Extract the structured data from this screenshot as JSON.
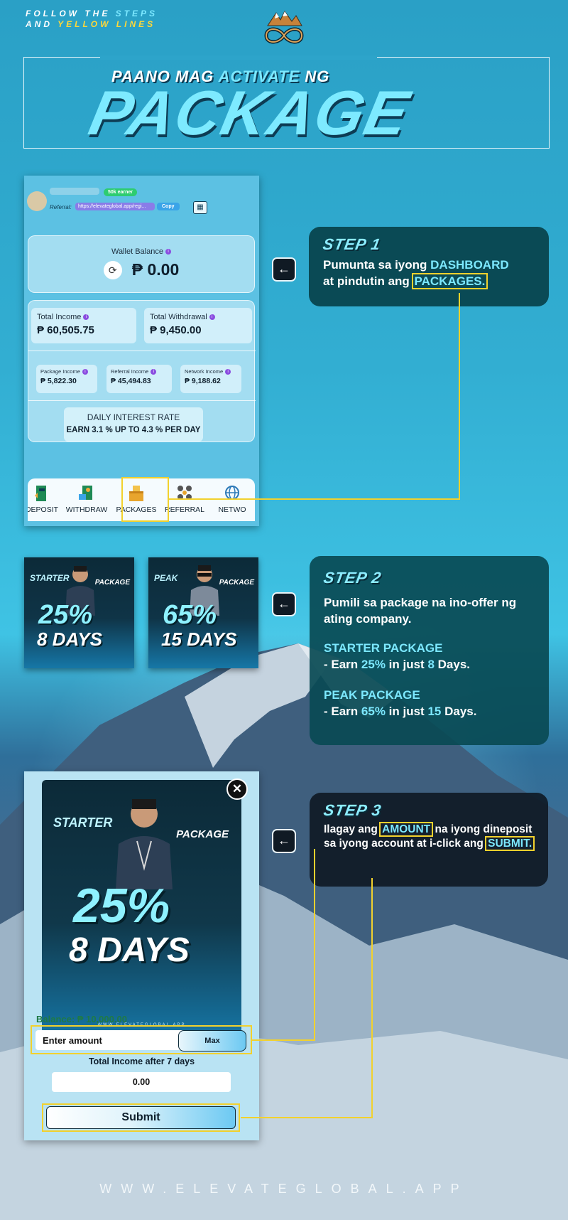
{
  "header": {
    "note_line1_prefix": "FOLLOW THE ",
    "note_line1_accent": "STEPS",
    "note_line2_prefix": "AND ",
    "note_line2_accent": "YELLOW LINES",
    "subtitle_prefix": "PAANO MAG ",
    "subtitle_accent": "ACTIVATE",
    "subtitle_suffix": " NG",
    "title": "PACKAGE"
  },
  "dashboard": {
    "badge": "50k earner",
    "referral_label": "Referral:",
    "referral_link": "https://elevateglobal.app/regi...",
    "copy_label": "Copy",
    "wallet_label": "Wallet Balance",
    "wallet_amount": "₱ 0.00",
    "total_income_label": "Total Income",
    "total_income_value": "₱ 60,505.75",
    "total_withdrawal_label": "Total Withdrawal",
    "total_withdrawal_value": "₱ 9,450.00",
    "package_income_label": "Package Income",
    "package_income_value": "₱ 5,822.30",
    "referral_income_label": "Referral Income",
    "referral_income_value": "₱ 45,494.83",
    "network_income_label": "Network Income",
    "network_income_value": "₱ 9,188.62",
    "rate_label": "DAILY INTEREST RATE",
    "rate_value": "EARN 3.1 % UP TO 4.3 % PER DAY",
    "nav": {
      "deposit": "DEPOSIT",
      "withdraw": "WITHDRAW",
      "packages": "PACKAGES",
      "referral": "REFERRAL",
      "network": "NETWO"
    }
  },
  "step1": {
    "title": "STEP 1",
    "text_a": "Pumunta sa iyong ",
    "text_b": "DASHBOARD",
    "text_c": "at pindutin ang ",
    "text_d": "PACKAGES."
  },
  "thumbs": {
    "starter": {
      "name": "STARTER",
      "package": "PACKAGE",
      "percent": "25%",
      "days": "8 DAYS"
    },
    "peak": {
      "name": "PEAK",
      "package": "PACKAGE",
      "percent": "65%",
      "days": "15 DAYS"
    }
  },
  "step2": {
    "title": "STEP 2",
    "intro": "Pumili sa package na ino-offer ng ating company.",
    "starter_name": "STARTER PACKAGE",
    "starter_a": "- Earn ",
    "starter_pct": "25%",
    "starter_b": " in just ",
    "starter_days": "8",
    "starter_c": " Days.",
    "peak_name": "PEAK PACKAGE",
    "peak_a": "- Earn ",
    "peak_pct": "65%",
    "peak_b": " in just ",
    "peak_days": "15",
    "peak_c": " Days."
  },
  "modal": {
    "name": "STARTER",
    "package": "PACKAGE",
    "percent": "25%",
    "days": "8 DAYS",
    "site": "WWW.ELEVATEGLOBAL.APP",
    "close": "✕",
    "balance": "Balance: ₱ 10,000.00",
    "amount_placeholder": "Enter amount",
    "max_label": "Max",
    "total_label": "Total Income after 7 days",
    "total_value": "0.00",
    "submit_label": "Submit"
  },
  "step3": {
    "title": "STEP 3",
    "text_a": "Ilagay ang ",
    "text_b": "AMOUNT",
    "text_c": " na iyong dineposit sa iyong account at i-click ang ",
    "text_d": "SUBMIT."
  },
  "arrow_glyph": "←",
  "footer": "WWW.ELEVATEGLOBAL.APP",
  "colors": {
    "accent_cyan": "#7ce8ff",
    "highlight_yellow": "#f2d12d"
  }
}
